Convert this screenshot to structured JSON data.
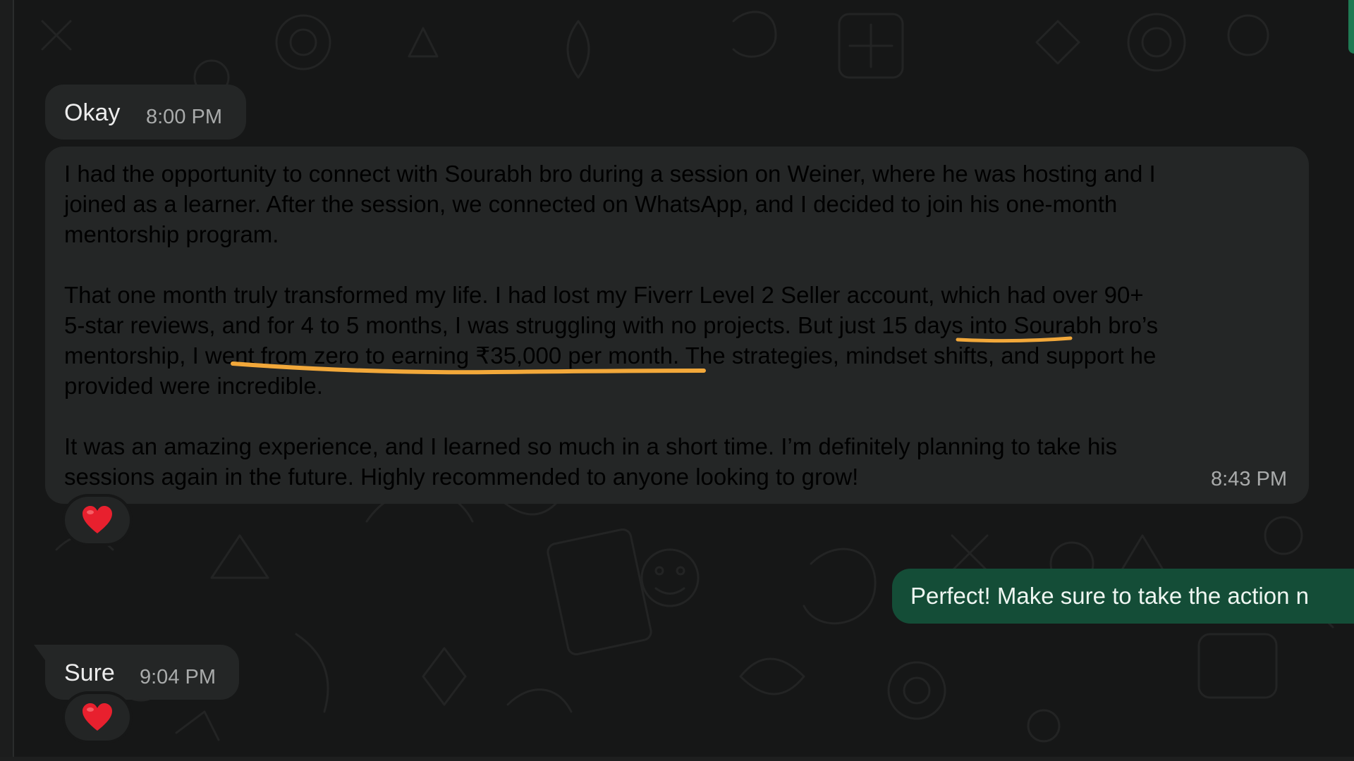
{
  "colors": {
    "background": "#161717",
    "incoming_bubble": "#242626",
    "outgoing_bubble": "#144d37",
    "text": "#ececec",
    "timestamp": "#a9abab",
    "highlight_underline": "#f2a83a",
    "reaction_heart": "#e8202e"
  },
  "messages": {
    "okay": {
      "text": "Okay",
      "time": "8:00 PM"
    },
    "testimonial": {
      "paragraphs": [
        [
          "I had the opportunity to connect with Sourabh bro during a session on Weiner, where he was hosting and I",
          "joined as a learner. After the session, we connected on WhatsApp, and I decided to join his one-month",
          "mentorship program."
        ],
        [
          "That one month truly transformed my life. I had lost my Fiverr Level 2 Seller account, which had over 90+",
          "5-star reviews, and for 4 to 5 months, I was struggling with no projects. But just 15 days into Sourabh bro’s",
          "mentorship, I went from zero to earning ₹35,000 per month. The strategies, mindset shifts, and support he",
          "provided were incredible."
        ],
        [
          "It was an amazing experience, and I learned so much in a short time. I’m definitely planning to take his",
          "sessions again in the future. Highly recommended to anyone looking to grow!"
        ]
      ],
      "time": "8:43 PM",
      "reaction": "heart-emoji"
    },
    "outgoing": {
      "text": "Perfect! Make sure to take the action n"
    },
    "sure": {
      "text": "Sure",
      "time": "9:04 PM",
      "reaction": "heart-emoji"
    }
  }
}
